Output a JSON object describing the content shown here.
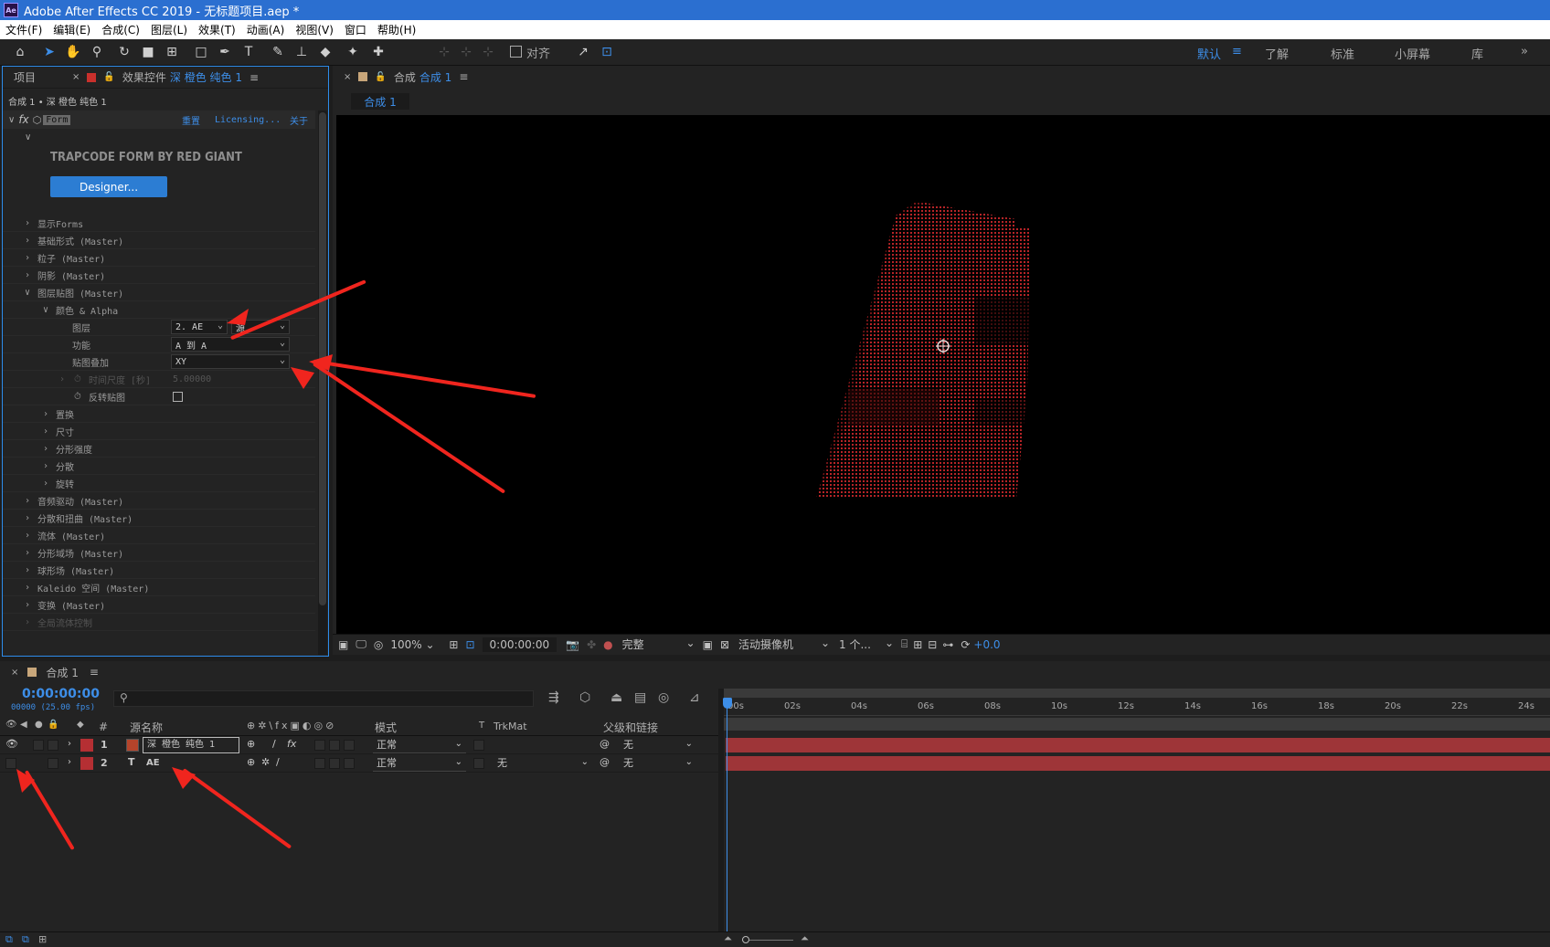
{
  "window": {
    "title": "Adobe After Effects CC 2019 - 无标题项目.aep *",
    "icon_label": "Ae"
  },
  "menu": [
    "文件(F)",
    "编辑(E)",
    "合成(C)",
    "图层(L)",
    "效果(T)",
    "动画(A)",
    "视图(V)",
    "窗口",
    "帮助(H)"
  ],
  "toolbar": {
    "align_label": "对齐",
    "workspaces": [
      "默认",
      "了解",
      "标准",
      "小屏幕",
      "库"
    ],
    "overflow": "»"
  },
  "project_panel": {
    "tab_label": "项目"
  },
  "effect_controls": {
    "tab_prefix": "效果控件",
    "tab_layer": "深 橙色 纯色 1",
    "breadcrumb": "合成 1 • 深 橙色 纯色 1",
    "effect_name": "Form",
    "reset": "重置",
    "licensing": "Licensing...",
    "about": "关于",
    "plugin_title": "TRAPCODE FORM BY RED GIANT",
    "designer_button": "Designer...",
    "groups": [
      "显示Forms",
      "基础形式 (Master)",
      "粒子 (Master)",
      "阴影 (Master)",
      "图层贴图 (Master)",
      "颜色 & Alpha",
      "图层",
      "功能",
      "贴图叠加",
      "时间尺度 [秒]",
      "反转贴图",
      "置换",
      "尺寸",
      "分形强度",
      "分散",
      "旋转",
      "音频驱动 (Master)",
      "分散和扭曲 (Master)",
      "流体 (Master)",
      "分形域场 (Master)",
      "球形场 (Master)",
      "Kaleido 空间 (Master)",
      "变换 (Master)",
      "全局流体控制"
    ],
    "layer_value": "2. AE",
    "layer_source": "源",
    "function_value": "A 到 A",
    "overlay_value": "XY",
    "time_scale_value": "5.00000"
  },
  "composition_panel": {
    "tab_label": "合成",
    "comp_name": "合成 1",
    "sub_tab": "合成 1",
    "preview_text": "AE",
    "bottom_bar": {
      "zoom": "100%",
      "timecode": "0:00:00:00",
      "quality": "完整",
      "camera": "活动摄像机",
      "views": "1 个...",
      "exposure": "+0.0"
    }
  },
  "timeline": {
    "tab_label": "合成 1",
    "timecode": "0:00:00:00",
    "frame_info": "00000 (25.00 fps)",
    "search_placeholder": "",
    "headers": {
      "num": "#",
      "source_name": "源名称",
      "mode": "模式",
      "t": "T",
      "trkmat": "TrkMat",
      "parent": "父级和链接"
    },
    "ruler": [
      "00s",
      "02s",
      "04s",
      "06s",
      "08s",
      "10s",
      "12s",
      "14s",
      "16s",
      "18s",
      "20s",
      "22s",
      "24s"
    ],
    "layers": [
      {
        "num": "1",
        "name": "深 橙色 纯色 1",
        "mode": "正常",
        "trkmat": "",
        "parent": "无",
        "color": "#b5442b"
      },
      {
        "num": "2",
        "name": "AE",
        "mode": "正常",
        "trkmat": "无",
        "parent": "无",
        "color": "#b52f33"
      }
    ]
  },
  "colors": {
    "accent": "#3d8ee8",
    "title_bar": "#2b6fd0",
    "annotation": "#f0251e",
    "track_bar": "#9e3538"
  }
}
